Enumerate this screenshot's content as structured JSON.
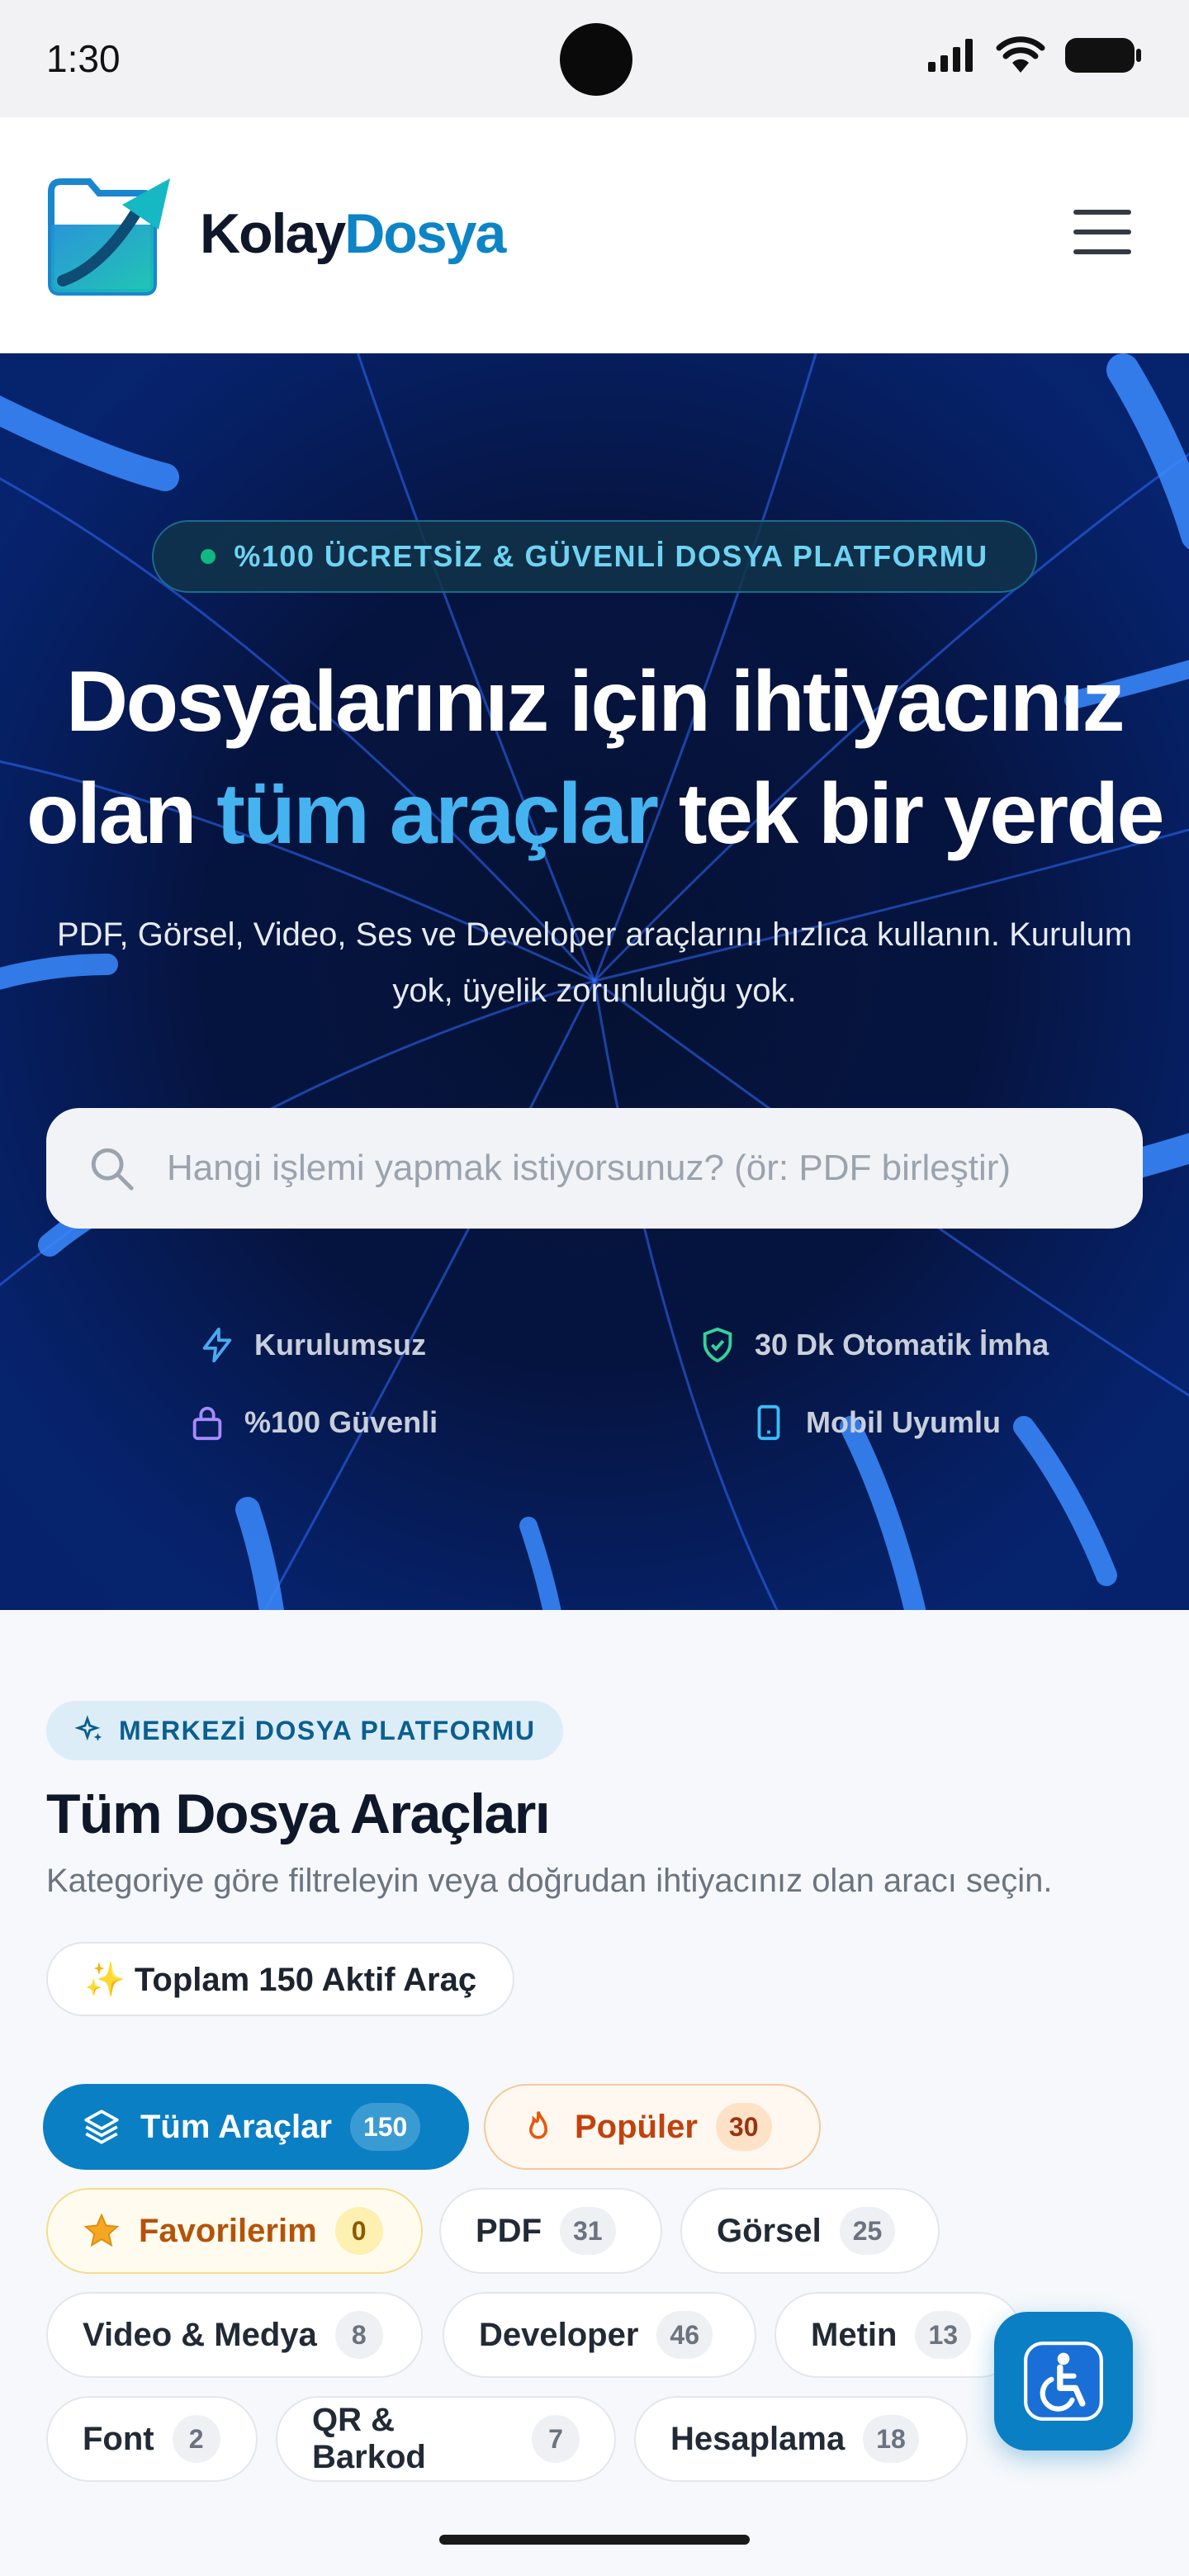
{
  "status": {
    "time": "1:30"
  },
  "brand": {
    "part1": "Kolay",
    "part2": "Dosya"
  },
  "hero": {
    "badge": "%100 ÜCRETSİZ & GÜVENLİ DOSYA PLATFORMU",
    "title_line1": "Dosyalarınız için ihtiyacınız",
    "title_line2_pre": "olan ",
    "title_line2_accent": "tüm araçlar",
    "title_line2_post": " tek bir yerde",
    "subtitle": "PDF, Görsel, Video, Ses ve Developer araçlarını hızlıca kullanın. Kurulum yok, üyelik zorunluluğu yok.",
    "search_placeholder": "Hangi işlemi yapmak istiyorsunuz? (ör: PDF birleştir)",
    "features": [
      "Kurulumsuz",
      "30 Dk Otomatik İmha",
      "%100 Güvenli",
      "Mobil Uyumlu"
    ]
  },
  "tools": {
    "tag": "MERKEZİ DOSYA PLATFORMU",
    "title": "Tüm Dosya Araçları",
    "description": "Kategoriye göre filtreleyin veya doğrudan ihtiyacınız olan aracı seçin.",
    "total": "✨ Toplam 150 Aktif Araç",
    "categories": [
      {
        "label": "Tüm Araçlar",
        "count": "150"
      },
      {
        "label": "Popüler",
        "count": "30"
      },
      {
        "label": "Favorilerim",
        "count": "0"
      },
      {
        "label": "PDF",
        "count": "31"
      },
      {
        "label": "Görsel",
        "count": "25"
      },
      {
        "label": "Video & Medya",
        "count": "8"
      },
      {
        "label": "Developer",
        "count": "46"
      },
      {
        "label": "Metin",
        "count": "13"
      },
      {
        "label": "Font",
        "count": "2"
      },
      {
        "label": "QR & Barkod",
        "count": "7"
      },
      {
        "label": "Hesaplama",
        "count": "18"
      }
    ]
  },
  "colors": {
    "brand": "#0d84c6",
    "accent": "#45b3ef",
    "hero_bg": "#040a22"
  }
}
